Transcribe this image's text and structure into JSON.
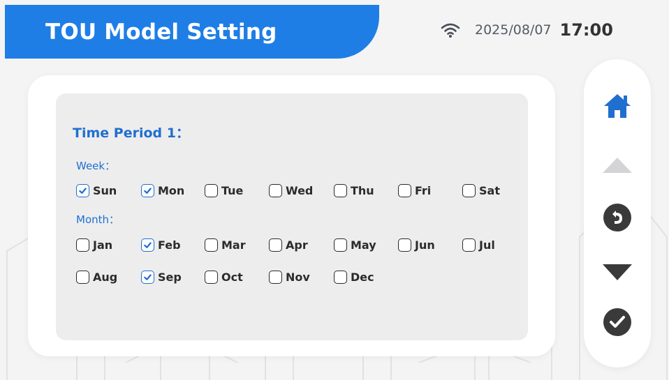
{
  "header": {
    "title": "TOU Model Setting",
    "date": "2025/08/07",
    "time": "17:00",
    "wifi_icon": "wifi-icon"
  },
  "period": {
    "title": "Time Period 1："
  },
  "week": {
    "label": "Week：",
    "days": [
      {
        "label": "Sun",
        "checked": true
      },
      {
        "label": "Mon",
        "checked": true
      },
      {
        "label": "Tue",
        "checked": false
      },
      {
        "label": "Wed",
        "checked": false
      },
      {
        "label": "Thu",
        "checked": false
      },
      {
        "label": "Fri",
        "checked": false
      },
      {
        "label": "Sat",
        "checked": false
      }
    ]
  },
  "month": {
    "label": "Month：",
    "months": [
      {
        "label": "Jan",
        "checked": false
      },
      {
        "label": "Feb",
        "checked": true
      },
      {
        "label": "Mar",
        "checked": false
      },
      {
        "label": "Apr",
        "checked": false
      },
      {
        "label": "May",
        "checked": false
      },
      {
        "label": "Jun",
        "checked": false
      },
      {
        "label": "Jul",
        "checked": false
      },
      {
        "label": "Aug",
        "checked": false
      },
      {
        "label": "Sep",
        "checked": true
      },
      {
        "label": "Oct",
        "checked": false
      },
      {
        "label": "Nov",
        "checked": false
      },
      {
        "label": "Dec",
        "checked": false
      }
    ]
  },
  "sidebar": {
    "buttons": [
      "home-icon",
      "up-icon",
      "back-icon",
      "down-icon",
      "confirm-icon"
    ]
  },
  "colors": {
    "accent": "#1f7ee6",
    "text_blue": "#1f6fcf",
    "home_blue": "#1f6fcf",
    "disabled": "#d4d4d6",
    "dark_icon": "#3a3a3a"
  }
}
